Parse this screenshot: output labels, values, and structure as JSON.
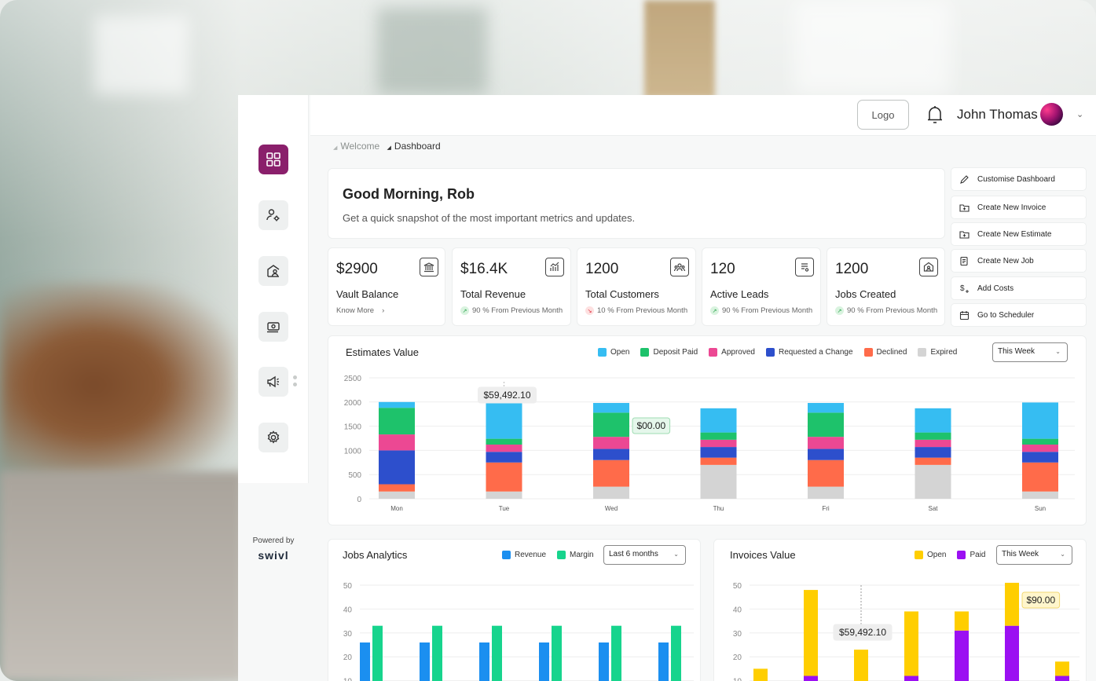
{
  "header": {
    "logo_label": "Logo",
    "user_name": "John Thomas"
  },
  "breadcrumb": {
    "parent": "Welcome",
    "current": "Dashboard"
  },
  "sidebar": {
    "items": [
      {
        "icon": "dashboard-grid-icon",
        "active": true
      },
      {
        "icon": "user-settings-icon",
        "active": false
      },
      {
        "icon": "home-user-icon",
        "active": false
      },
      {
        "icon": "money-icon",
        "active": false
      },
      {
        "icon": "megaphone-icon",
        "active": false
      },
      {
        "icon": "gear-icon",
        "active": false
      }
    ],
    "powered_by": "Powered by",
    "brand": "swivl"
  },
  "welcome": {
    "title": "Good Morning, Rob",
    "subtitle": "Get a quick snapshot of the most important metrics and updates."
  },
  "stats": [
    {
      "value": "$2900",
      "label": "Vault Balance",
      "sub": "Know More",
      "trend": "link",
      "icon": "bank-icon"
    },
    {
      "value": "$16.4K",
      "label": "Total Revenue",
      "sub": "90 % From Previous Month",
      "trend": "up",
      "icon": "chart-icon"
    },
    {
      "value": "1200",
      "label": "Total Customers",
      "sub": "10 %  From Previous Month",
      "trend": "down",
      "icon": "customers-icon"
    },
    {
      "value": "120",
      "label": "Active Leads",
      "sub": "90 % From Previous Month",
      "trend": "up",
      "icon": "leads-icon"
    },
    {
      "value": "1200",
      "label": "Jobs Created",
      "sub": "90 % From Previous Month",
      "trend": "up",
      "icon": "jobs-icon"
    }
  ],
  "actions": [
    {
      "label": "Customise Dashboard",
      "icon": "pencil-icon"
    },
    {
      "label": "Create New Invoice",
      "icon": "folder-plus-icon"
    },
    {
      "label": "Create New Estimate",
      "icon": "folder-plus-icon"
    },
    {
      "label": "Create New Job",
      "icon": "document-icon"
    },
    {
      "label": "Add Costs",
      "icon": "dollar-plus-icon"
    },
    {
      "label": "Go to Scheduler",
      "icon": "calendar-icon"
    }
  ],
  "chart_data": [
    {
      "type": "bar",
      "title": "Estimates Value",
      "stacked": true,
      "filter": "This Week",
      "categories": [
        "Mon",
        "Tue",
        "Wed",
        "Thu",
        "Fri",
        "Sat",
        "Sun"
      ],
      "yticks": [
        "2500",
        "2000",
        "1500",
        "1000",
        "500",
        "0"
      ],
      "ylim": [
        0,
        2500
      ],
      "series": [
        {
          "name": "Expired",
          "color": "#d4d4d4",
          "values": [
            150,
            150,
            250,
            700,
            250,
            700,
            150
          ]
        },
        {
          "name": "Declined",
          "color": "#ff6b4a",
          "values": [
            150,
            600,
            550,
            150,
            550,
            150,
            600
          ]
        },
        {
          "name": "Requested a Change",
          "color": "#2d4fcc",
          "values": [
            700,
            220,
            230,
            220,
            230,
            220,
            220
          ]
        },
        {
          "name": "Approved",
          "color": "#ec4893",
          "values": [
            330,
            150,
            250,
            150,
            250,
            150,
            150
          ]
        },
        {
          "name": "Deposit Paid",
          "color": "#1ec26b",
          "values": [
            550,
            120,
            500,
            150,
            500,
            150,
            120
          ]
        },
        {
          "name": "Open",
          "color": "#36bdf2",
          "values": [
            120,
            750,
            200,
            500,
            200,
            500,
            750
          ]
        }
      ],
      "legend": [
        "Open",
        "Deposit Paid",
        "Approved",
        "Requested a Change",
        "Declined",
        "Expired"
      ],
      "annotations": [
        "$59,492.10",
        "$00.00"
      ]
    },
    {
      "type": "bar",
      "title": "Jobs Analytics",
      "filter": "Last 6 months",
      "yticks": [
        "50",
        "40",
        "30",
        "20",
        "10"
      ],
      "ylim": [
        0,
        50
      ],
      "series": [
        {
          "name": "Revenue",
          "color": "#1b8ff0",
          "values": [
            26,
            26,
            26,
            26,
            26,
            26
          ]
        },
        {
          "name": "Margin",
          "color": "#17d48d",
          "values": [
            33,
            33,
            33,
            33,
            33,
            33
          ]
        }
      ]
    },
    {
      "type": "bar",
      "title": "Invoices Value",
      "stacked": true,
      "filter": "This Week",
      "yticks": [
        "50",
        "40",
        "30",
        "20",
        "10"
      ],
      "ylim": [
        0,
        50
      ],
      "series": [
        {
          "name": "Paid",
          "color": "#9b10f2",
          "values": [
            0,
            12,
            0,
            12,
            31,
            33,
            12
          ]
        },
        {
          "name": "Open",
          "color": "#ffce00",
          "values": [
            15,
            36,
            23,
            27,
            8,
            18,
            6
          ]
        }
      ],
      "annotations": [
        "$59,492.10",
        "$90.00"
      ]
    }
  ]
}
